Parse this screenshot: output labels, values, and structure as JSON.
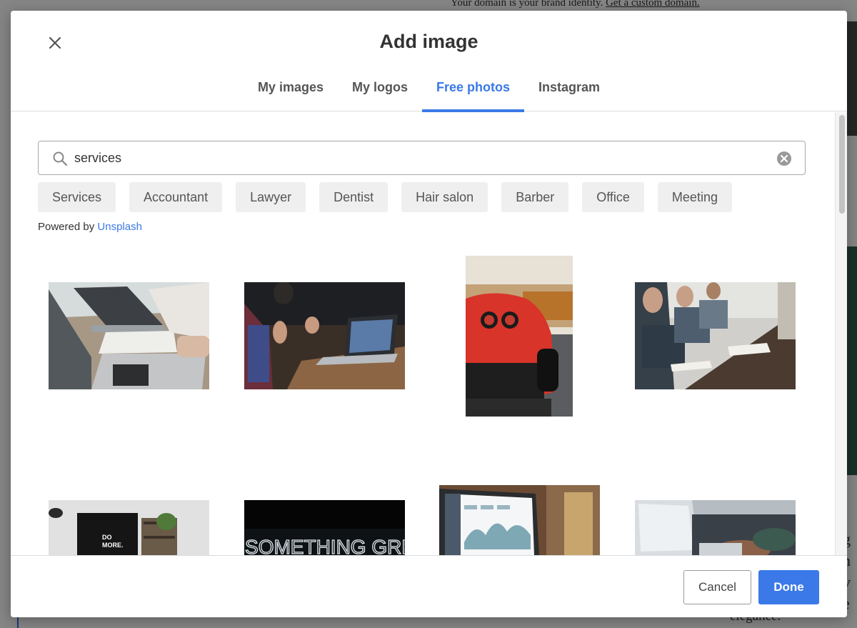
{
  "background": {
    "top_text": "Your domain is your brand identity.",
    "top_link": "Get a custom domain.",
    "bottom_text": "elegance.",
    "right_glyphs": [
      "g",
      "n v",
      "e"
    ]
  },
  "modal": {
    "title": "Add image",
    "tabs": [
      {
        "label": "My images",
        "active": false
      },
      {
        "label": "My logos",
        "active": false
      },
      {
        "label": "Free photos",
        "active": true
      },
      {
        "label": "Instagram",
        "active": false
      }
    ],
    "search": {
      "value": "services"
    },
    "chips": [
      "Services",
      "Accountant",
      "Lawyer",
      "Dentist",
      "Hair salon",
      "Barber",
      "Office",
      "Meeting"
    ],
    "powered_by": "Powered by",
    "powered_link": "Unsplash",
    "images": [
      "laptop-desk-paperwork-photo",
      "laptop-meeting-hands-photo",
      "red-sports-car-photo",
      "people-at-table-writing-photo",
      "do-more-monitor-photo",
      "do-something-great-neon-sign-photo",
      "laptop-analytics-dashboard-photo",
      "hands-typing-laptop-photo"
    ],
    "neon_text": "DO SOMETHING GREAT",
    "monitor_text": [
      "DO",
      "MORE."
    ],
    "footer": {
      "cancel_label": "Cancel",
      "done_label": "Done"
    }
  },
  "colors": {
    "accent": "#3b79e8",
    "chip_bg": "#efefef",
    "title": "#333333"
  }
}
